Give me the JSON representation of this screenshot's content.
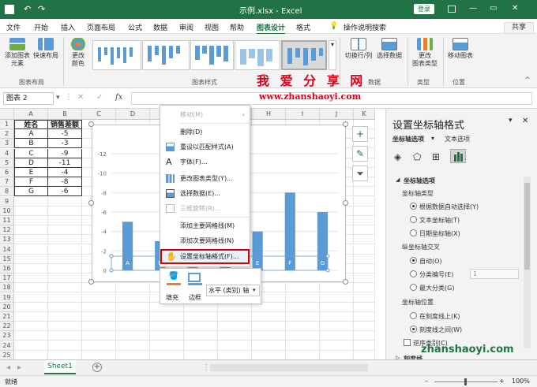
{
  "titlebar": {
    "title": "示例.xlsx - Excel",
    "login": "登录",
    "min": "—",
    "restore": "▭",
    "close": "✕",
    "undo": "↶",
    "redo": "↷"
  },
  "menu": {
    "tabs": [
      "文件",
      "开始",
      "插入",
      "页面布局",
      "公式",
      "数据",
      "审阅",
      "视图",
      "帮助",
      "图表设计",
      "格式"
    ],
    "search": "操作说明搜索",
    "share": "共享"
  },
  "ribbon": {
    "add_element": "添加图表\n元素",
    "quick_layout": "快速布局",
    "change_colors": "更改\n颜色",
    "switch_row_col": "切换行/列",
    "select_data": "选择数据",
    "change_type": "更改\n图表类型",
    "move_chart": "移动图表",
    "groups": [
      "图表布局",
      "图表样式",
      "数据",
      "类型",
      "位置"
    ]
  },
  "watermark": {
    "site_cn": "我 爱 分 享 网",
    "site_url": "www.zhanshaoyi.com",
    "bottom": "zhanshaoyi.com"
  },
  "formula": {
    "name_box": "图表 2",
    "fx": "fx"
  },
  "grid": {
    "columns": [
      "A",
      "B",
      "C",
      "D",
      "E",
      "F",
      "G",
      "H",
      "I",
      "J",
      "K"
    ],
    "rows": [
      "1",
      "2",
      "3",
      "4",
      "5",
      "6",
      "7",
      "8",
      "9",
      "10",
      "11",
      "12",
      "13",
      "14",
      "15",
      "16",
      "17",
      "18",
      "19",
      "20",
      "21",
      "22",
      "23",
      "24",
      "25"
    ],
    "headers": [
      "姓名",
      "销售差额"
    ],
    "data": [
      [
        "A",
        "-5"
      ],
      [
        "B",
        "-3"
      ],
      [
        "C",
        "-9"
      ],
      [
        "D",
        "-11"
      ],
      [
        "E",
        "-4"
      ],
      [
        "F",
        "-8"
      ],
      [
        "G",
        "-6"
      ]
    ]
  },
  "chart_data": {
    "type": "bar",
    "categories": [
      "A",
      "B",
      "C",
      "D",
      "E",
      "F",
      "G"
    ],
    "values": [
      -5,
      -3,
      -9,
      -11,
      -4,
      -8,
      -6
    ],
    "ylim": [
      -12,
      0
    ],
    "yticks": [
      "-12",
      "-10",
      "-8",
      "-6",
      "-4",
      "-2",
      "0"
    ],
    "axis_reversed": true,
    "color": "#5b9bd5"
  },
  "context_menu": {
    "items": [
      "移动(M)",
      "删除(D)",
      "重设以匹配样式(A)",
      "字体(F)...",
      "更改图表类型(Y)...",
      "选择数据(E)...",
      "三维旋转(R)...",
      "添加主要网格线(M)",
      "添加次要网格线(N)",
      "设置坐标轴格式(F)..."
    ]
  },
  "mini_toolbar": {
    "fill": "填充",
    "border": "边框",
    "dropdown": "水平 (类别) 轴"
  },
  "pane": {
    "title": "设置坐标轴格式",
    "tabs": [
      "坐标轴选项",
      "文本选项"
    ],
    "section": "坐标轴选项",
    "axis_type_label": "坐标轴类型",
    "axis_type_options": [
      "根据数据自动选择(Y)",
      "文本坐标轴(T)",
      "日期坐标轴(X)"
    ],
    "cross_label": "纵坐标轴交叉",
    "cross_options": [
      "自动(O)",
      "分类编号(E)",
      "最大分类(G)"
    ],
    "cross_value": "1",
    "position_label": "坐标轴位置",
    "position_options": [
      "在刻度线上(K)",
      "刻度线之间(W)"
    ],
    "reverse": "逆序类别(C)",
    "tick_marks": "刻度线"
  },
  "sheet_tab": "Sheet1",
  "status": {
    "ready": "就绪",
    "zoom": "100%"
  }
}
